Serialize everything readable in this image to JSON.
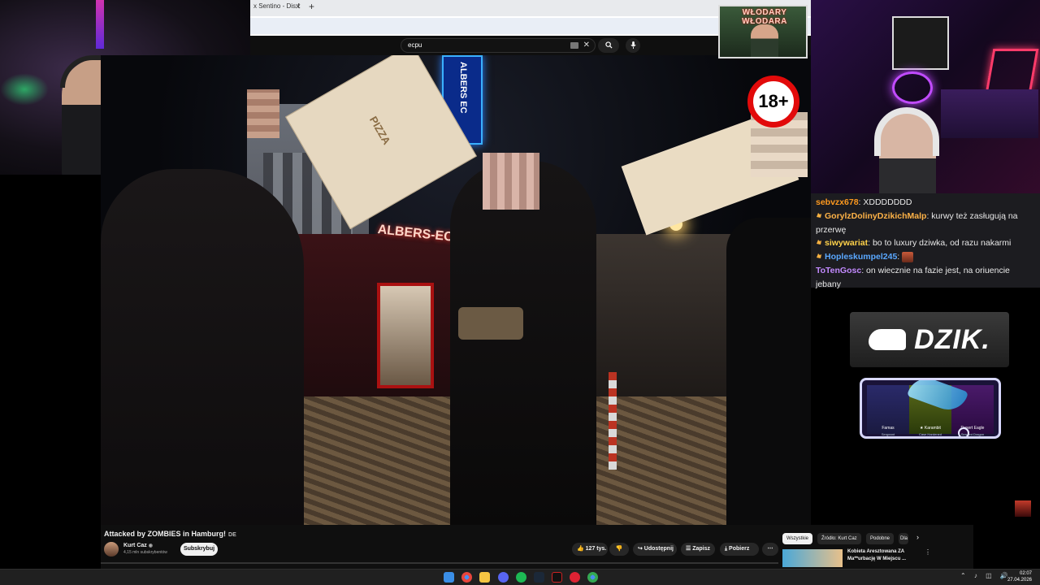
{
  "browser": {
    "tab_title": "x Sentino - Dis f",
    "tab_close": "✕",
    "new_tab": "+"
  },
  "youtube": {
    "search_value": "ecpu",
    "search_clear": "✕",
    "search_icon": "search-icon",
    "mic_icon": "mic-icon"
  },
  "overlay": {
    "poster_title": "WŁODARY WŁODARA",
    "age_badge": "18+",
    "dzik_logo": "DZIK.",
    "case_items": [
      {
        "name": "Famas",
        "sub": "Sergeant"
      },
      {
        "name": "★ Karambit",
        "sub": "Case Hardened"
      },
      {
        "name": "Desert Eagle",
        "sub": "Serpent Dragon"
      }
    ]
  },
  "video_scene": {
    "bar_sign": "ALBERS-EC",
    "vertical_sign": "ALBERS EC",
    "pizza_text": "PIZZA"
  },
  "chat": {
    "messages": [
      {
        "user": "sebvzx678",
        "color": "#ff9a1f",
        "badge": false,
        "text": "XDDDDDDD"
      },
      {
        "user": "GorylzDolinyDzikichMalp",
        "color": "#ffb347",
        "badge": true,
        "text": "kurwy też zasługują na przerwę"
      },
      {
        "user": "siwywariat",
        "color": "#ffd24a",
        "badge": true,
        "text": "bo to luxury dziwka, od razu nakarmi"
      },
      {
        "user": "Hopleskumpel245",
        "color": "#5aa8ff",
        "badge": true,
        "text": ""
      },
      {
        "user": "ToTenGosc",
        "color": "#c38aff",
        "badge": false,
        "text": "on wiecznie na fazie jest, na oriuencie jebany"
      }
    ]
  },
  "video_info": {
    "title": "Attacked by ZOMBIES in Hamburg!",
    "title_flag": "DE",
    "channel": "Kurt Caz",
    "verified": "◉",
    "subscribers": "4,15 mln subskrybentów",
    "subscribe": "Subskrybuj",
    "likes": "👍 127 tys.",
    "dislike": "👎",
    "share": "↪ Udostępnij",
    "save": "☰ Zapisz",
    "download": "⤓ Pobierz",
    "more": "⋯"
  },
  "rail": {
    "chips": [
      "Wszystkie",
      "Źródło: Kurt Caz",
      "Podobne",
      "Dla"
    ],
    "next": "›",
    "rec_title": "Kobieta Aresztowana ZA Ma**urbację W Miejscu ...",
    "rec_menu": "⋮"
  },
  "taskbar": {
    "time": "02:07",
    "date": "27.04.2026",
    "tray": "⌃ ♪ ◫ 🔊"
  }
}
